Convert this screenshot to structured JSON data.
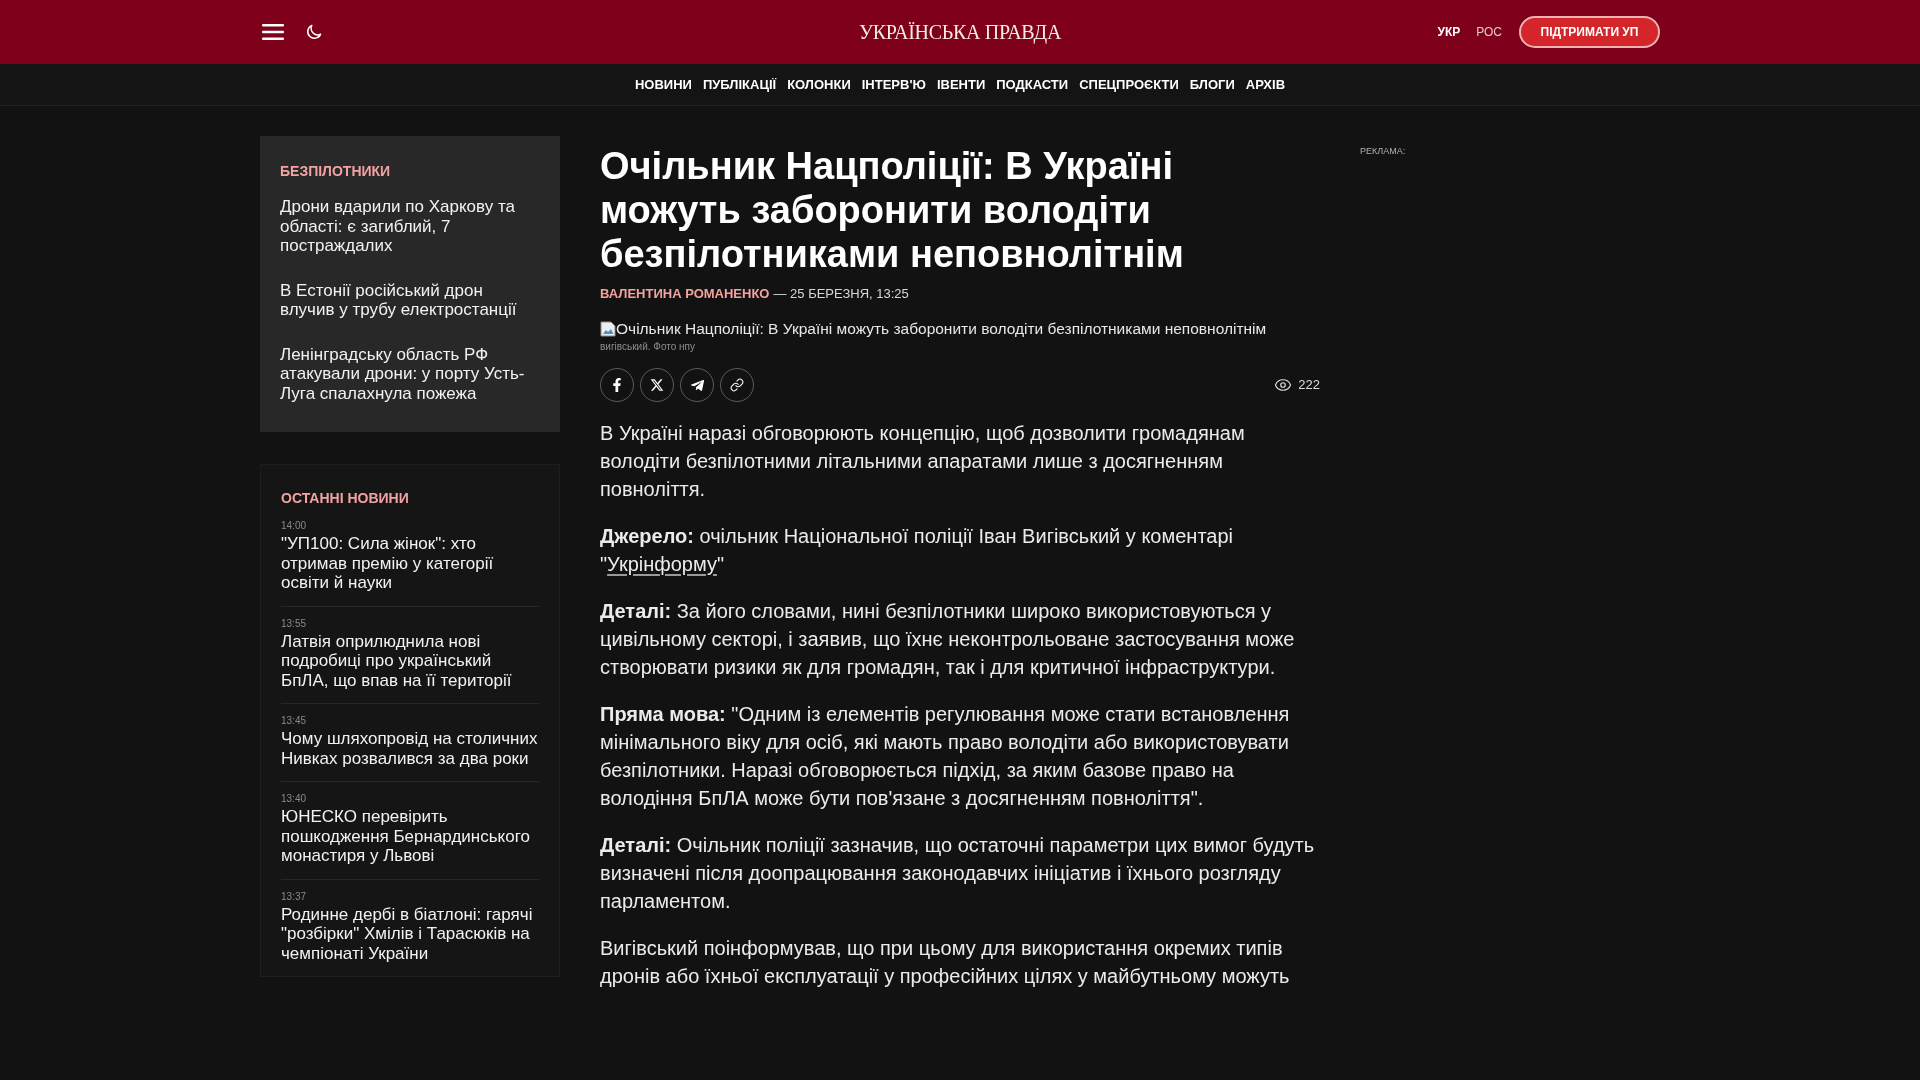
{
  "header": {
    "logo": "УКРАЇНСЬКА ПРАВДА",
    "languages": [
      {
        "label": "УКР",
        "selected": true
      },
      {
        "label": "РОС",
        "selected": false
      }
    ],
    "support_button": "ПІДТРИМАТИ УП"
  },
  "nav": {
    "items": [
      "НОВИНИ",
      "ПУБЛІКАЦІЇ",
      "КОЛОНКИ",
      "ІНТЕРВ'Ю",
      "ІВЕНТИ",
      "ПОДКАСТИ",
      "СПЕЦПРОЄКТИ",
      "БЛОГИ",
      "АРХІВ"
    ]
  },
  "sidebar": {
    "topic_card": {
      "title": "БЕЗПІЛОТНИКИ",
      "items": [
        "Дрони вдарили по Харкову та області: є загиблий, 7 постраждалих",
        "В Естонії російський дрон влучив у трубу електростанції",
        "Ленінградську область РФ атакували дрони: у порту Усть-Луга спалахнула пожежа"
      ]
    },
    "latest_news": {
      "title": "ОСТАННІ НОВИНИ",
      "items": [
        {
          "time": "14:00",
          "headline": "\"УП100: Сила жінок\": хто отримав премію у категорії освіти й науки"
        },
        {
          "time": "13:55",
          "headline": "Латвія оприлюднила нові подробиці про український БпЛА, що впав на її території"
        },
        {
          "time": "13:45",
          "headline": "Чому шляхопровід на столичних Нивках розвалився за два роки"
        },
        {
          "time": "13:40",
          "headline": "ЮНЕСКО перевірить пошкодження Бернардинського монастиря у Львові"
        },
        {
          "time": "13:37",
          "headline": "Родинне дербі в біатлоні: гарячі \"розбірки\" Хмілів і Тарасюків на чемпіонаті України"
        }
      ]
    }
  },
  "article": {
    "title": "Очільник Нацполіції: В Україні можуть заборонити володіти безпілотниками неповнолітнім",
    "author": "ВАЛЕНТИНА РОМАНЕНКО",
    "date": "— 25 БЕРЕЗНЯ, 13:25",
    "image_alt": "Очільник Нацполіції: В Україні можуть заборонити володіти безпілотниками неповнолітнім",
    "image_caption": "вигівський. Фото нпу",
    "views": "222",
    "paragraphs": [
      {
        "text": "В Україні наразі обговорюють концепцію, щоб дозволити громадянам володіти безпілотними літальними апаратами лише з досягненням повноліття."
      },
      {
        "text": "**Джерело:** очільник Національної поліції Іван Вигівський у коментарі \"",
        "link": "Укрінформу",
        "text_after": "\""
      },
      {
        "text": "**Деталі:** За його словами, нині безпілотники широко використовуються у цивільному секторі, і заявив, що їхнє неконтрольоване застосування може створювати ризики як для громадян, так і для критичної інфраструктури."
      },
      {
        "text": "**Пряма мова:** \"Одним із елементів регулювання може стати встановлення мінімального віку для осіб, які мають право володіти або використовувати безпілотники. Наразі обговорюється підхід, за яким базове право на володіння БпЛА може бути пов'язане з досягненням повноліття\"."
      },
      {
        "text": "**Деталі:** Очільник поліції зазначив, що остаточні параметри цих вимог будуть визначені після доопрацювання законодавчих ініціатив і їхнього розгляду парламентом."
      },
      {
        "text": "Вигівський поінформував, що при цьому для використання окремих типів дронів або їхньої експлуатації у професійних цілях у майбутньому можуть"
      }
    ]
  },
  "ad": {
    "label": "РЕКЛАМА:"
  }
}
